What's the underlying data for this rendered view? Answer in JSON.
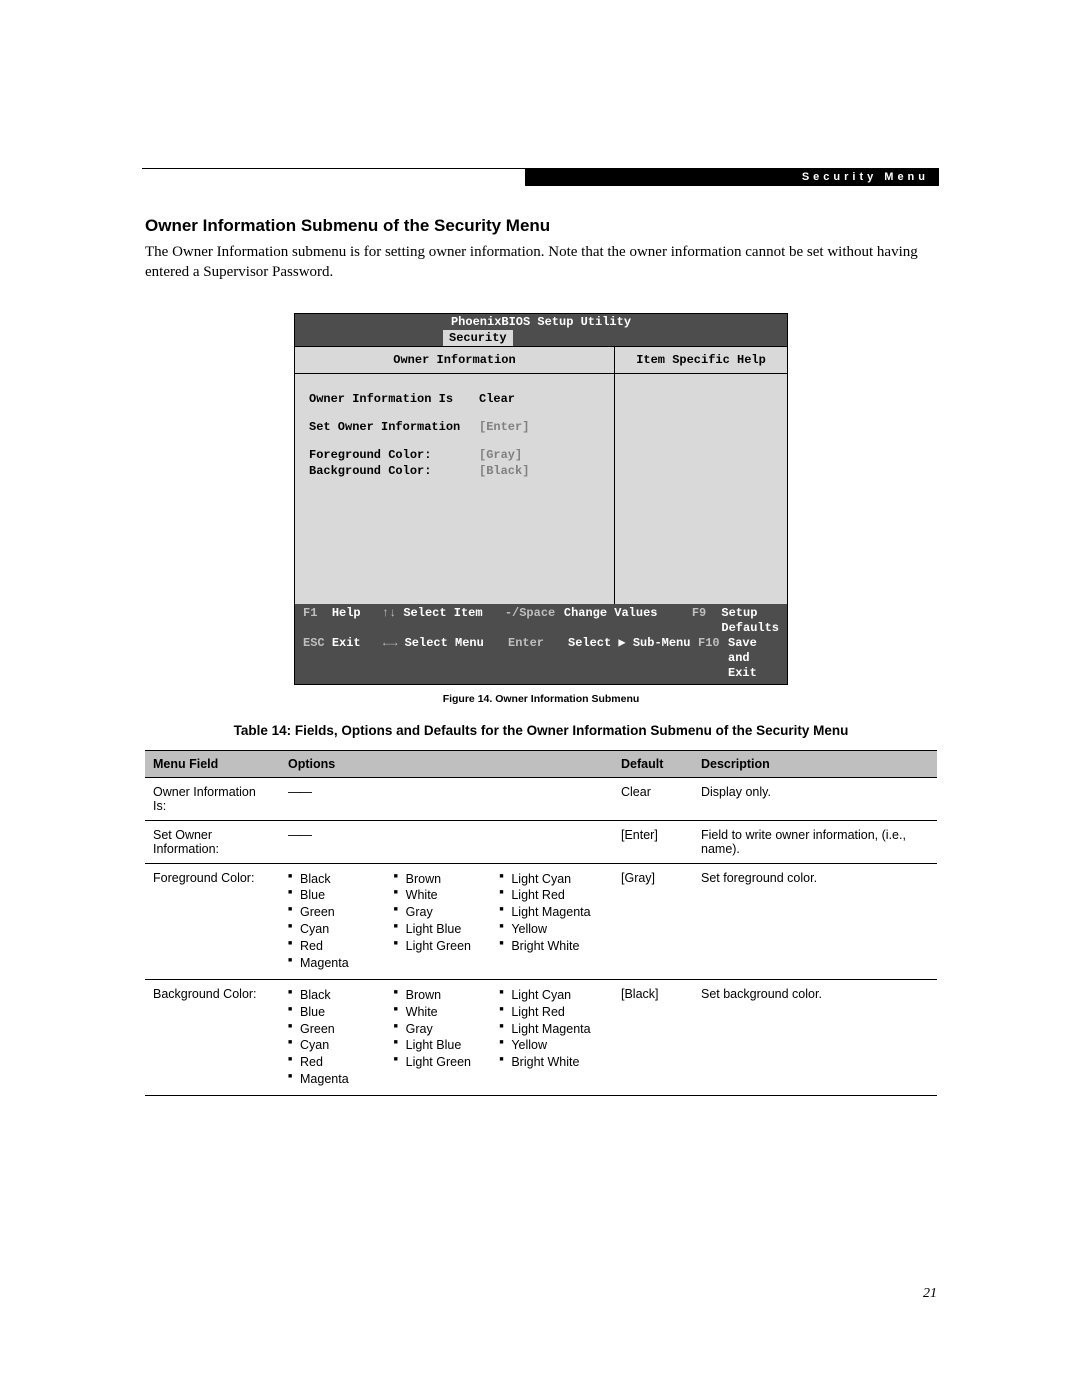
{
  "header": {
    "bar_label": "Security Menu"
  },
  "section": {
    "title": "Owner Information Submenu of the Security Menu",
    "intro": "The Owner Information submenu is for setting owner information. Note that the owner information cannot be set without having entered a Supervisor Password."
  },
  "bios": {
    "utility_title": "PhoenixBIOS Setup Utility",
    "active_tab": "Security",
    "left_header": "Owner Information",
    "right_header": "Item Specific Help",
    "items": {
      "owner_info_is": {
        "label": "Owner Information Is",
        "value": "Clear",
        "dim": false
      },
      "set_owner_info": {
        "label": "Set Owner Information",
        "value": "[Enter]",
        "dim": true
      },
      "fg_color": {
        "label": "Foreground Color:",
        "value": "[Gray]",
        "dim": true
      },
      "bg_color": {
        "label": "Background Color:",
        "value": "[Black]",
        "dim": true
      }
    },
    "footer": {
      "r1": {
        "c1k": "F1",
        "c1v": "Help",
        "c2a": "↑↓",
        "c2v": "Select Item",
        "c3": "-/Space",
        "c4": "Change Values",
        "c5": "F9",
        "c6": "Setup Defaults"
      },
      "r2": {
        "c1k": "ESC",
        "c1v": "Exit",
        "c2a": "←→",
        "c2v": "Select Menu",
        "c3": "Enter",
        "c4": "Select ▶ Sub-Menu",
        "c5": "F10",
        "c6": "Save and Exit"
      }
    }
  },
  "figure_caption": "Figure 14.  Owner Information Submenu",
  "table_caption": "Table 14: Fields, Options and Defaults for the Owner Information Submenu of the Security Menu",
  "table": {
    "headers": {
      "field": "Menu Field",
      "options": "Options",
      "def": "Default",
      "desc": "Description"
    },
    "rows": [
      {
        "field": "Owner Information Is:",
        "options_dash": "——",
        "options_cols": null,
        "def": "Clear",
        "desc": "Display only."
      },
      {
        "field": "Set Owner Information:",
        "options_dash": "——",
        "options_cols": null,
        "def": "[Enter]",
        "desc": "Field to write owner infor­mation, (i.e., name)."
      },
      {
        "field": "Foreground Color:",
        "options_dash": null,
        "options_cols": [
          [
            "Black",
            "Blue",
            "Green",
            "Cyan",
            "Red",
            "Magenta"
          ],
          [
            "Brown",
            "White",
            "Gray",
            "Light Blue",
            "Light Green"
          ],
          [
            "Light Cyan",
            "Light Red",
            "Light Magenta",
            "Yellow",
            "Bright White"
          ]
        ],
        "def": "[Gray]",
        "desc": "Set foreground color."
      },
      {
        "field": "Background Color:",
        "options_dash": null,
        "options_cols": [
          [
            "Black",
            "Blue",
            "Green",
            "Cyan",
            "Red",
            "Magenta"
          ],
          [
            "Brown",
            "White",
            "Gray",
            "Light Blue",
            "Light Green"
          ],
          [
            "Light Cyan",
            "Light Red",
            "Light Magenta",
            "Yellow",
            "Bright White"
          ]
        ],
        "def": "[Black]",
        "desc": "Set background color."
      }
    ]
  },
  "page_number": "21"
}
